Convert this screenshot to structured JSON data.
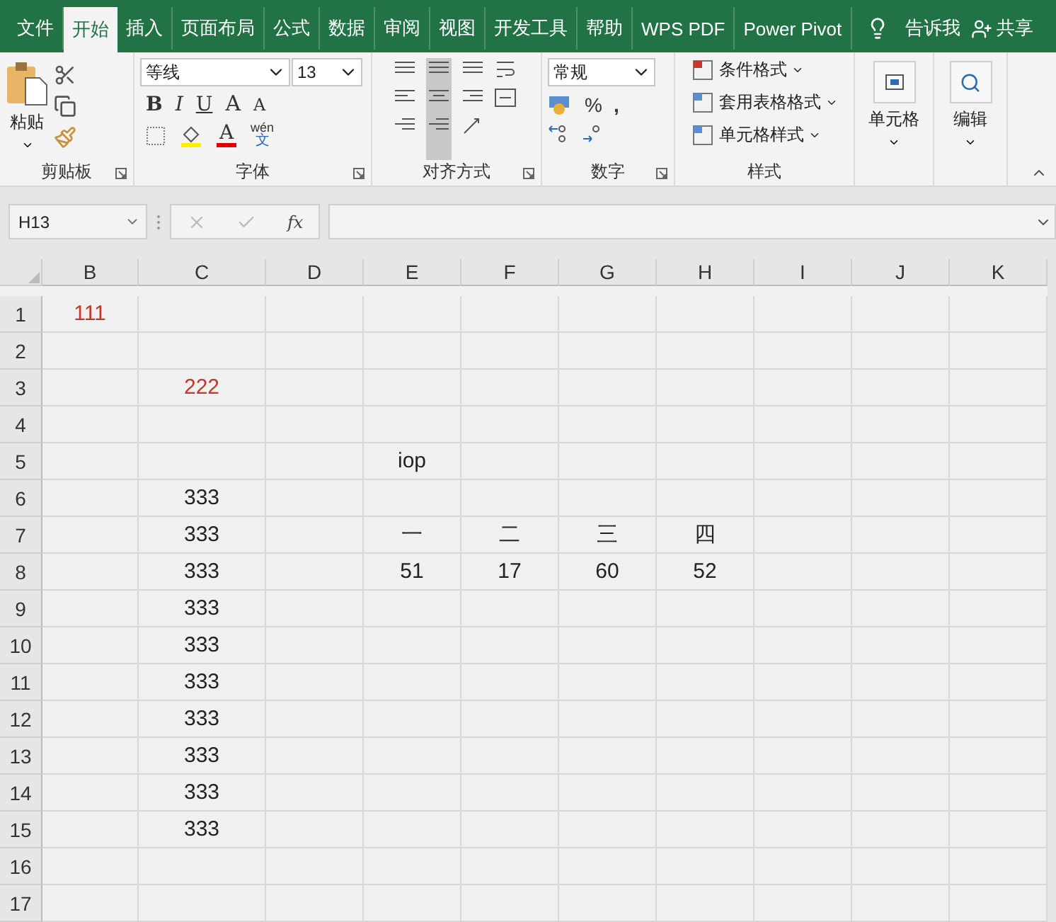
{
  "tabs": [
    {
      "label": "文件",
      "selected": false
    },
    {
      "label": "开始",
      "selected": true
    },
    {
      "label": "插入",
      "selected": false
    },
    {
      "label": "页面布局",
      "selected": false
    },
    {
      "label": "公式",
      "selected": false
    },
    {
      "label": "数据",
      "selected": false
    },
    {
      "label": "审阅",
      "selected": false
    },
    {
      "label": "视图",
      "selected": false
    },
    {
      "label": "开发工具",
      "selected": false
    },
    {
      "label": "帮助",
      "selected": false
    },
    {
      "label": "WPS PDF",
      "selected": false
    },
    {
      "label": "Power Pivot",
      "selected": false
    }
  ],
  "tell_me": "告诉我",
  "share": "共享",
  "clipboard": {
    "paste": "粘贴",
    "label": "剪贴板"
  },
  "font": {
    "name": "等线",
    "size": "13",
    "bold": "B",
    "italic": "I",
    "underline": "U",
    "grow": "A",
    "shrink": "A",
    "font_color": "A",
    "phonetic_top": "wén",
    "phonetic_bottom": "文",
    "label": "字体"
  },
  "alignment": {
    "label": "对齐方式"
  },
  "number": {
    "format": "常规",
    "percent": "%",
    "comma": ",",
    "label": "数字"
  },
  "styles": {
    "items": [
      "条件格式",
      "套用表格格式",
      "单元格样式"
    ],
    "label": "样式"
  },
  "cells": {
    "label": "单元格"
  },
  "editing": {
    "label": "编辑"
  },
  "formula_bar": {
    "name_box": "H13",
    "fx": "fx"
  },
  "sheet": {
    "columns": [
      "B",
      "C",
      "D",
      "E",
      "F",
      "G",
      "H",
      "I",
      "J",
      "K"
    ],
    "rows": [
      {
        "header": "1",
        "cells": [
          {
            "text": "111",
            "color": "#c0392b"
          },
          null,
          null,
          null,
          null,
          null,
          null,
          null,
          null,
          null
        ]
      },
      {
        "header": "2",
        "cells": [
          null,
          null,
          null,
          null,
          null,
          null,
          null,
          null,
          null,
          null
        ]
      },
      {
        "header": "3",
        "cells": [
          null,
          {
            "text": "222",
            "color": "#c0392b"
          },
          null,
          null,
          null,
          null,
          null,
          null,
          null,
          null
        ]
      },
      {
        "header": "4",
        "cells": [
          null,
          null,
          null,
          null,
          null,
          null,
          null,
          null,
          null,
          null
        ]
      },
      {
        "header": "5",
        "cells": [
          null,
          null,
          null,
          {
            "text": "iop",
            "color": "#222222"
          },
          null,
          null,
          null,
          null,
          null,
          null
        ]
      },
      {
        "header": "6",
        "cells": [
          null,
          {
            "text": "333",
            "color": "#222222"
          },
          null,
          null,
          null,
          null,
          null,
          null,
          null,
          null
        ]
      },
      {
        "header": "7",
        "cells": [
          null,
          {
            "text": "333",
            "color": "#222222"
          },
          null,
          {
            "text": "一",
            "color": "#222222"
          },
          {
            "text": "二",
            "color": "#222222"
          },
          {
            "text": "三",
            "color": "#222222"
          },
          {
            "text": "四",
            "color": "#222222"
          },
          null,
          null,
          null
        ]
      },
      {
        "header": "8",
        "cells": [
          null,
          {
            "text": "333",
            "color": "#222222"
          },
          null,
          {
            "text": "51",
            "color": "#222222"
          },
          {
            "text": "17",
            "color": "#222222"
          },
          {
            "text": "60",
            "color": "#222222"
          },
          {
            "text": "52",
            "color": "#222222"
          },
          null,
          null,
          null
        ]
      },
      {
        "header": "9",
        "cells": [
          null,
          {
            "text": "333",
            "color": "#222222"
          },
          null,
          null,
          null,
          null,
          null,
          null,
          null,
          null
        ]
      },
      {
        "header": "10",
        "cells": [
          null,
          {
            "text": "333",
            "color": "#222222"
          },
          null,
          null,
          null,
          null,
          null,
          null,
          null,
          null
        ]
      },
      {
        "header": "11",
        "cells": [
          null,
          {
            "text": "333",
            "color": "#222222"
          },
          null,
          null,
          null,
          null,
          null,
          null,
          null,
          null
        ]
      },
      {
        "header": "12",
        "cells": [
          null,
          {
            "text": "333",
            "color": "#222222"
          },
          null,
          null,
          null,
          null,
          null,
          null,
          null,
          null
        ]
      },
      {
        "header": "13",
        "cells": [
          null,
          {
            "text": "333",
            "color": "#222222"
          },
          null,
          null,
          null,
          null,
          null,
          null,
          null,
          null
        ]
      },
      {
        "header": "14",
        "cells": [
          null,
          {
            "text": "333",
            "color": "#222222"
          },
          null,
          null,
          null,
          null,
          null,
          null,
          null,
          null
        ]
      },
      {
        "header": "15",
        "cells": [
          null,
          {
            "text": "333",
            "color": "#222222"
          },
          null,
          null,
          null,
          null,
          null,
          null,
          null,
          null
        ]
      },
      {
        "header": "16",
        "cells": [
          null,
          null,
          null,
          null,
          null,
          null,
          null,
          null,
          null,
          null
        ]
      },
      {
        "header": "17",
        "cells": [
          null,
          null,
          null,
          null,
          null,
          null,
          null,
          null,
          null,
          null
        ]
      }
    ]
  }
}
